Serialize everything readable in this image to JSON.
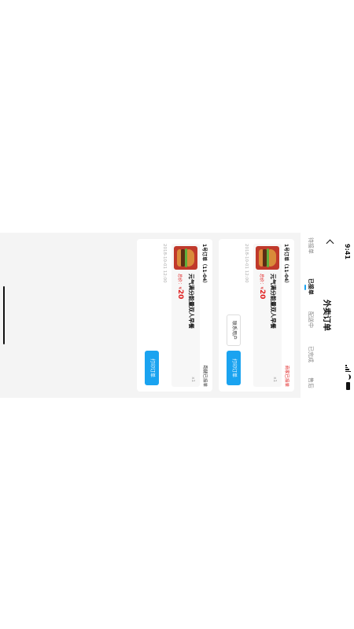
{
  "status_bar": {
    "time": "9:41"
  },
  "nav": {
    "title": "外卖订单"
  },
  "tabs": [
    {
      "label": "待接单",
      "active": false
    },
    {
      "label": "已接单",
      "active": true
    },
    {
      "label": "配送中",
      "active": false
    },
    {
      "label": "已完成",
      "active": false
    },
    {
      "label": "售后",
      "active": false
    }
  ],
  "orders": [
    {
      "id": "1号订单（11-04）",
      "status": "商家已接单",
      "status_color": "#e02020",
      "product": {
        "name": "元气满分能量双人早餐",
        "qty": "x1"
      },
      "total_label": "总价：",
      "currency": "¥",
      "total": "20",
      "datetime": "2018-10-01 12:00",
      "buttons": {
        "contact": "联系用户",
        "print": "打印订单"
      }
    },
    {
      "id": "1号订单（11-04）",
      "status": "跑腿已接单",
      "status_color": "#333333",
      "product": {
        "name": "元气满分能量双人早餐",
        "qty": "x1"
      },
      "total_label": "总价：",
      "currency": "¥",
      "total": "20",
      "datetime": "2018-10-01 12:00",
      "buttons": {
        "print": "打印订单"
      }
    }
  ],
  "colors": {
    "accent": "#1aa3f0",
    "price": "#e02020",
    "background": "#f4f4f4"
  }
}
